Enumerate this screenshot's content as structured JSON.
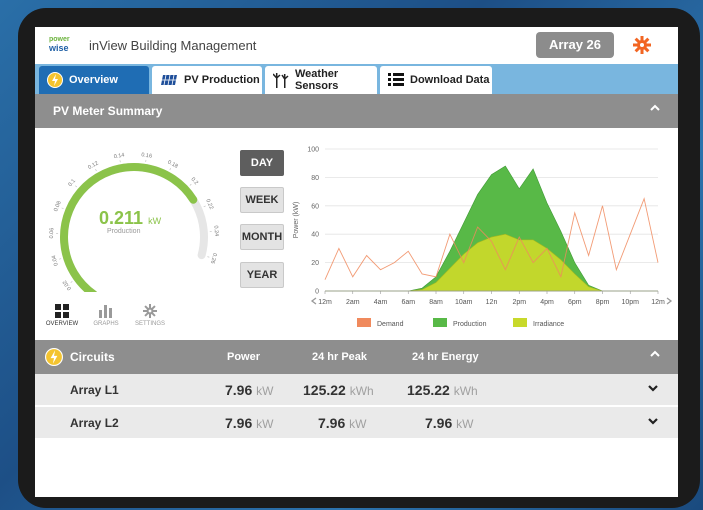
{
  "header": {
    "logo_line1": "power",
    "logo_line2": "wise",
    "title": "inView Building Management",
    "array_label": "Array 26"
  },
  "tabs": [
    {
      "label": "Overview",
      "icon": "lightning-icon",
      "active": true
    },
    {
      "label": "PV Production",
      "icon": "solar-panel-icon",
      "active": false
    },
    {
      "label": "Weather Sensors",
      "icon": "wind-turbine-icon",
      "active": false
    },
    {
      "label": "Download Data",
      "icon": "list-icon",
      "active": false
    }
  ],
  "summary": {
    "title": "PV Meter Summary",
    "gauge": {
      "value": "0.211",
      "unit": "kW",
      "label": "Production",
      "ticks": [
        "0",
        "0.02",
        "0.04",
        "0.06",
        "0.08",
        "0.1",
        "0.12",
        "0.14",
        "0.16",
        "0.18",
        "0.2",
        "0.22",
        "0.24",
        "0.26"
      ],
      "max": 0.26,
      "color": "#8bc34a"
    },
    "ranges": [
      {
        "label": "DAY",
        "active": true
      },
      {
        "label": "WEEK",
        "active": false
      },
      {
        "label": "MONTH",
        "active": false
      },
      {
        "label": "YEAR",
        "active": false
      }
    ],
    "mini_nav": [
      {
        "label": "OVERVIEW",
        "icon": "grid-icon",
        "active": true
      },
      {
        "label": "GRAPHS",
        "icon": "bar-chart-icon",
        "active": false
      },
      {
        "label": "SETTINGS",
        "icon": "gear-icon",
        "active": false
      }
    ]
  },
  "chart_data": {
    "type": "area",
    "ylabel": "Power (kW)",
    "ylim": [
      0,
      100
    ],
    "yticks": [
      "0",
      "20",
      "40",
      "60",
      "80",
      "100"
    ],
    "x_labels": [
      "12m",
      "2am",
      "4am",
      "6am",
      "8am",
      "10am",
      "12n",
      "2pm",
      "4pm",
      "6pm",
      "8pm",
      "10pm",
      "12m"
    ],
    "x": [
      0,
      1,
      2,
      3,
      4,
      5,
      6,
      7,
      8,
      9,
      10,
      11,
      12,
      13,
      14,
      15,
      16,
      17,
      18,
      19,
      20,
      21,
      22,
      23,
      24
    ],
    "series": [
      {
        "name": "Demand",
        "color": "#f08a5d",
        "values": [
          8,
          30,
          10,
          25,
          15,
          20,
          28,
          12,
          10,
          40,
          20,
          45,
          35,
          15,
          38,
          20,
          30,
          10,
          55,
          25,
          60,
          15,
          40,
          65,
          20
        ]
      },
      {
        "name": "Production",
        "color": "#58b947",
        "values": [
          0,
          0,
          0,
          0,
          0,
          0,
          0,
          2,
          10,
          28,
          48,
          68,
          82,
          88,
          72,
          86,
          62,
          42,
          20,
          4,
          0,
          0,
          0,
          0,
          0
        ]
      },
      {
        "name": "Irradiance",
        "color": "#c8d92b",
        "values": [
          0,
          0,
          0,
          0,
          0,
          0,
          0,
          1,
          6,
          16,
          26,
          34,
          38,
          40,
          36,
          36,
          30,
          22,
          12,
          3,
          0,
          0,
          0,
          0,
          0
        ]
      }
    ]
  },
  "circuits": {
    "title": "Circuits",
    "columns": [
      "Power",
      "24 hr Peak",
      "24 hr Energy"
    ],
    "rows": [
      {
        "name": "Array L1",
        "power": "7.96",
        "power_unit": "kW",
        "peak": "125.22",
        "peak_unit": "kWh",
        "energy": "125.22",
        "energy_unit": "kWh"
      },
      {
        "name": "Array L2",
        "power": "7.96",
        "power_unit": "kW",
        "peak": "7.96",
        "peak_unit": "kW",
        "energy": "7.96",
        "energy_unit": "kW"
      }
    ]
  },
  "colors": {
    "accent_blue": "#1f6db4",
    "tabbar_blue": "#79b6df",
    "header_gray": "#8e8e8e",
    "alert_orange": "#f26522"
  }
}
